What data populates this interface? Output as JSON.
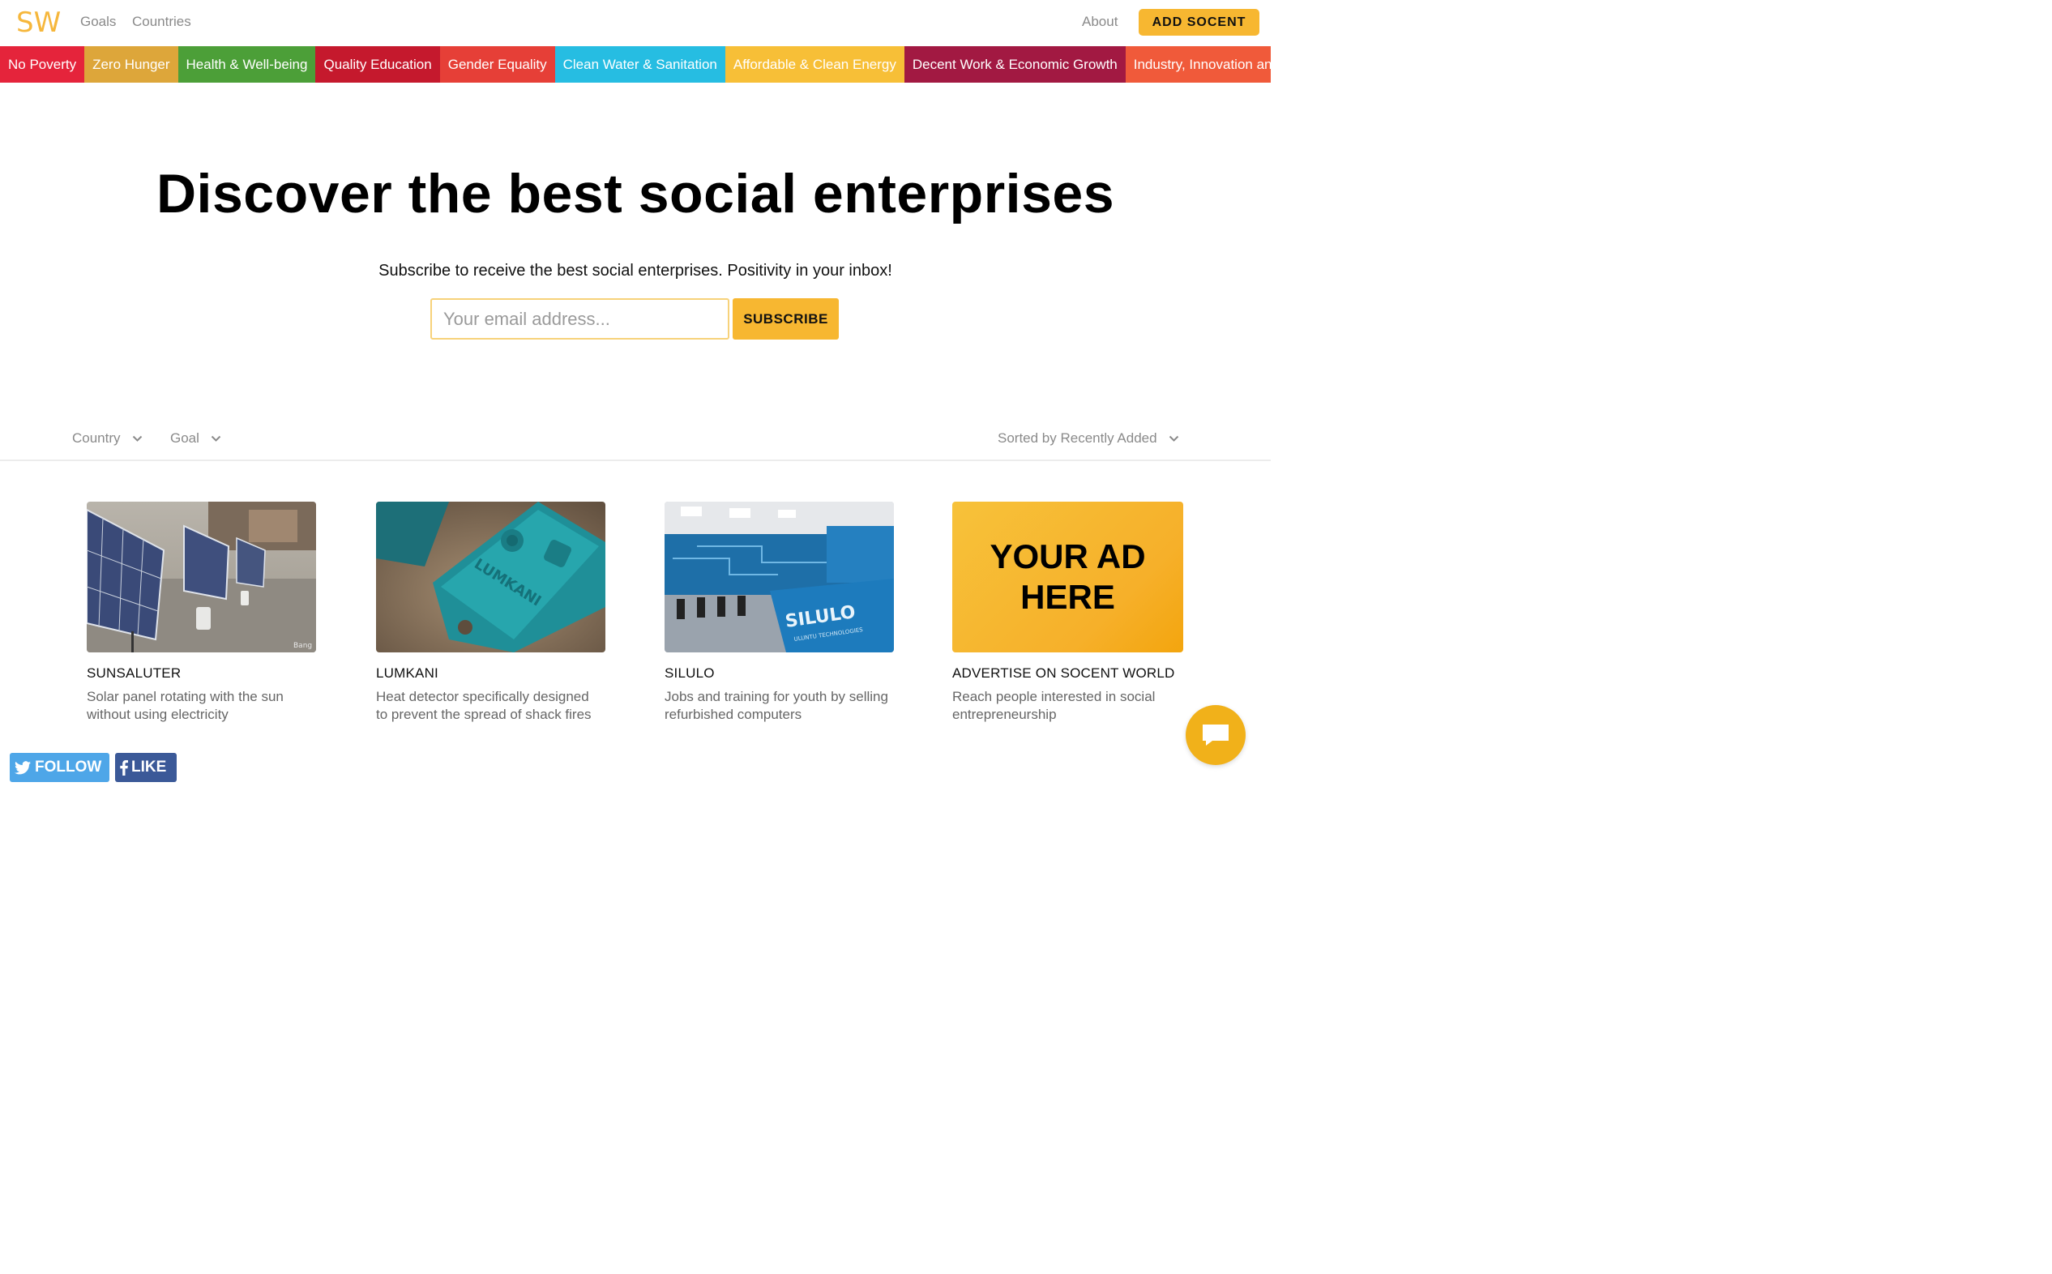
{
  "header": {
    "logo": "SW",
    "nav": {
      "goals": "Goals",
      "countries": "Countries",
      "about": "About"
    },
    "add_button": "ADD SOCENT"
  },
  "goals_bar": [
    {
      "label": "No Poverty",
      "color": "#e5243b"
    },
    {
      "label": "Zero Hunger",
      "color": "#dda63a"
    },
    {
      "label": "Health & Well-being",
      "color": "#4c9f38"
    },
    {
      "label": "Quality Education",
      "color": "#c5192d"
    },
    {
      "label": "Gender Equality",
      "color": "#e63f37"
    },
    {
      "label": "Clean Water & Sanitation",
      "color": "#26bde2"
    },
    {
      "label": "Affordable & Clean Energy",
      "color": "#f7bf37"
    },
    {
      "label": "Decent Work & Economic Growth",
      "color": "#a21942"
    },
    {
      "label": "Industry, Innovation and Infrastructure",
      "color": "#f05a3a"
    }
  ],
  "hero": {
    "title": "Discover the best social enterprises",
    "subtitle": "Subscribe to receive the best social enterprises. Positivity in your inbox!",
    "email_placeholder": "Your email address...",
    "subscribe_button": "SUBSCRIBE"
  },
  "filters": {
    "country": "Country",
    "goal": "Goal",
    "sort": "Sorted by Recently Added"
  },
  "cards": [
    {
      "title": "SUNSALUTER",
      "description": "Solar panel rotating with the sun without using electricity",
      "image_watermark": "Bang"
    },
    {
      "title": "LUMKANI",
      "description": "Heat detector specifically designed to prevent the spread of shack fires",
      "image_label": "LUMKANI"
    },
    {
      "title": "SILULO",
      "description": "Jobs and training for youth by selling refurbished computers",
      "image_label": "SILULO",
      "image_sublabel": "ULUNTU TECHNOLOGIES"
    },
    {
      "title": "ADVERTISE ON SOCENT WORLD",
      "description": "Reach people interested in social entrepreneurship",
      "ad_line1": "YOUR AD",
      "ad_line2": "HERE"
    }
  ],
  "social": {
    "follow": "FOLLOW",
    "like": "LIKE"
  },
  "colors": {
    "accent": "#f7b731",
    "twitter": "#4ea6e8",
    "facebook": "#3b5998"
  }
}
